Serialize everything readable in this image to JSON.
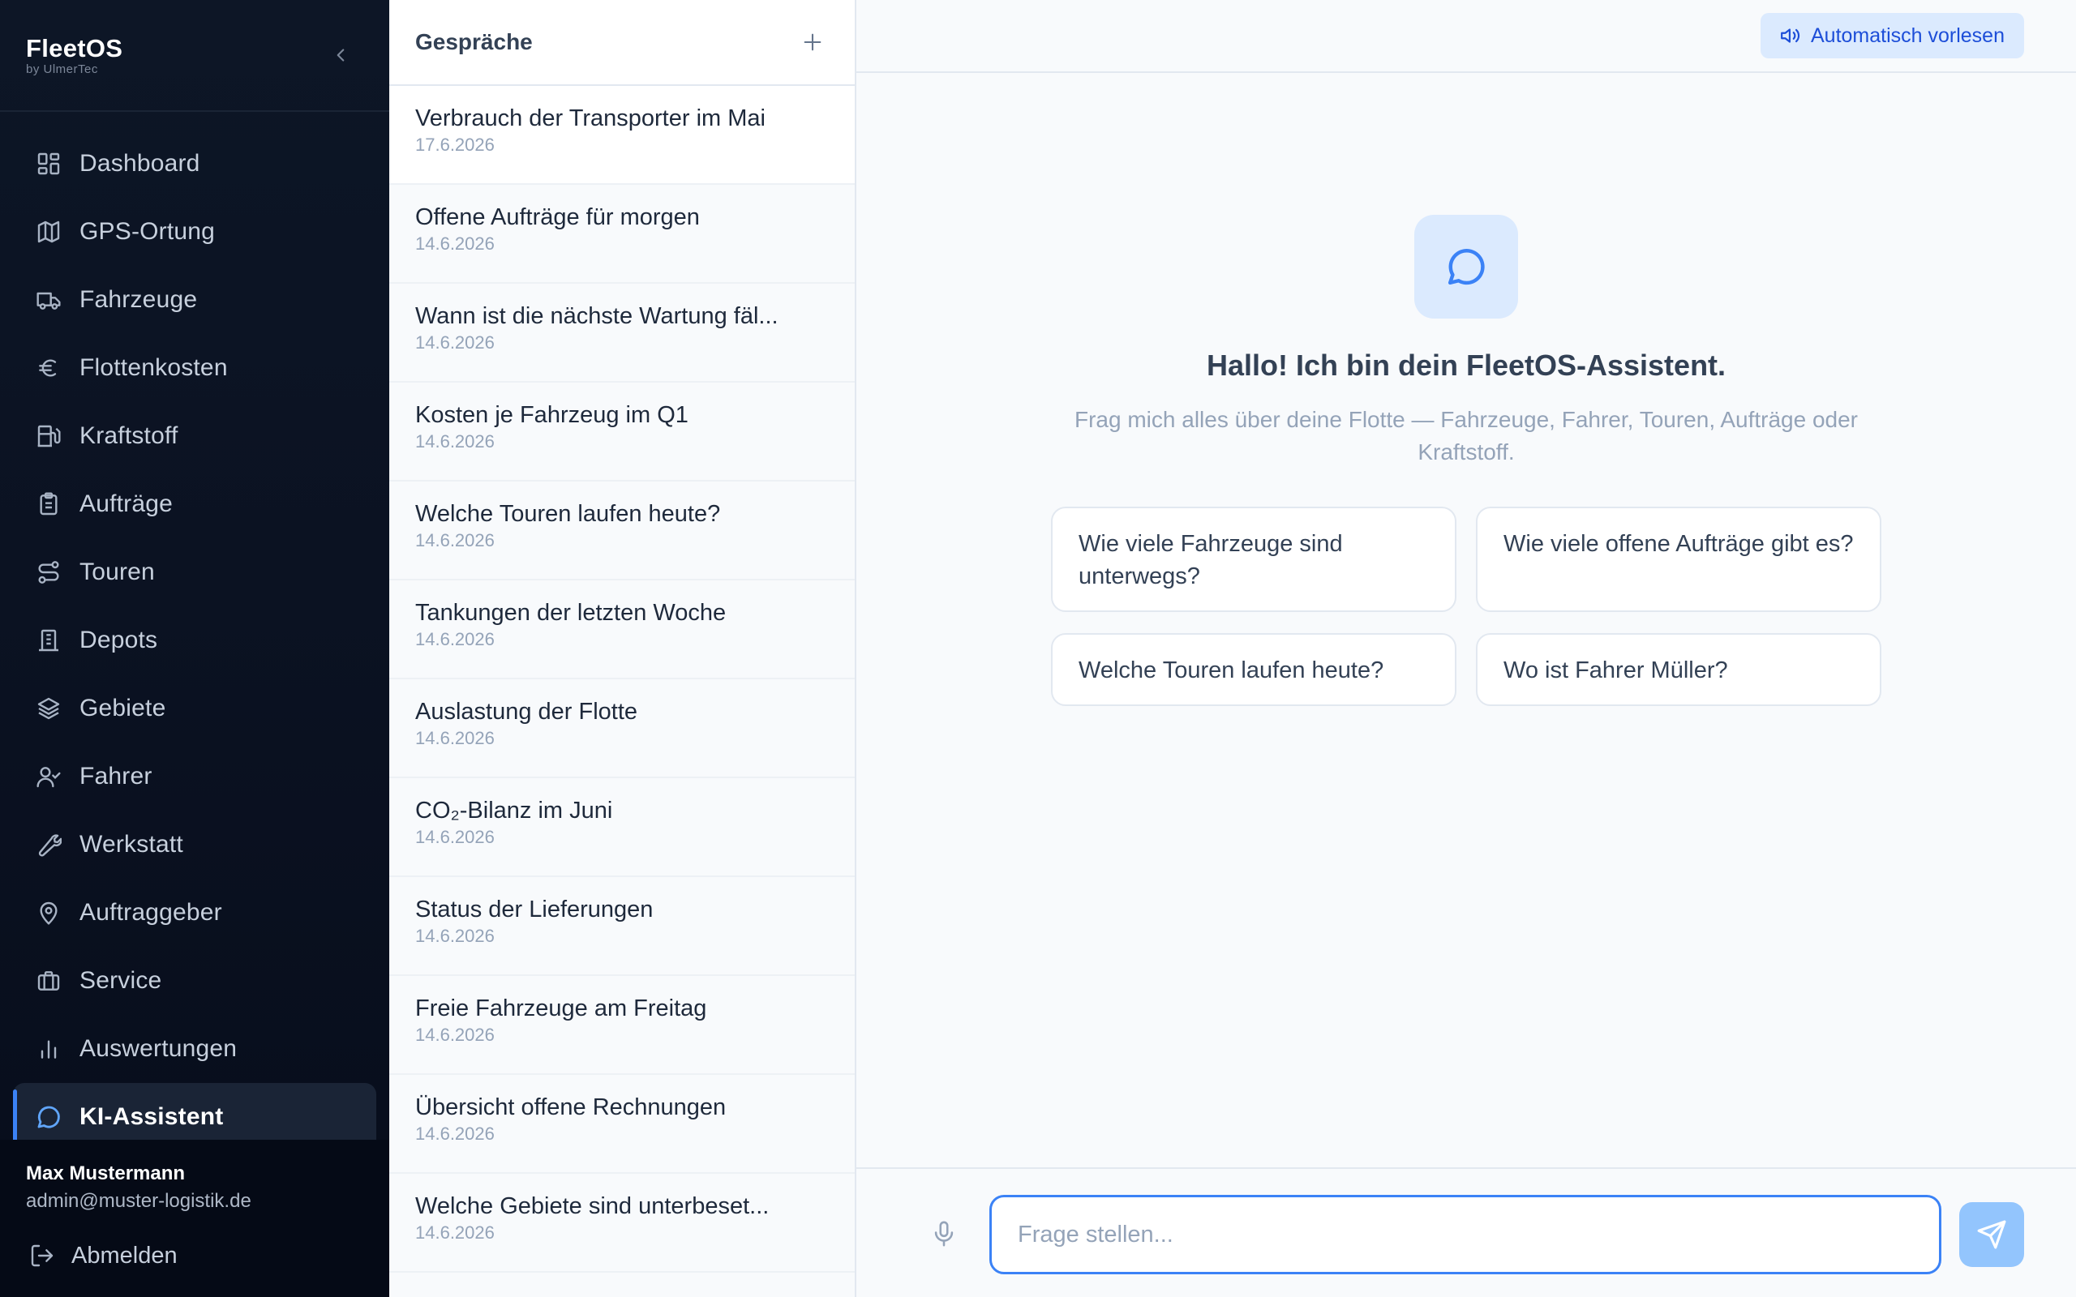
{
  "brand": {
    "name": "FleetOS",
    "subtitle": "by UlmerTec"
  },
  "sidebar": {
    "items": [
      {
        "label": "Dashboard",
        "icon": "dashboard-icon"
      },
      {
        "label": "GPS-Ortung",
        "icon": "map-icon"
      },
      {
        "label": "Fahrzeuge",
        "icon": "truck-icon"
      },
      {
        "label": "Flottenkosten",
        "icon": "euro-icon"
      },
      {
        "label": "Kraftstoff",
        "icon": "fuel-icon"
      },
      {
        "label": "Aufträge",
        "icon": "clipboard-icon"
      },
      {
        "label": "Touren",
        "icon": "route-icon"
      },
      {
        "label": "Depots",
        "icon": "building-icon"
      },
      {
        "label": "Gebiete",
        "icon": "layers-icon"
      },
      {
        "label": "Fahrer",
        "icon": "user-check-icon"
      },
      {
        "label": "Werkstatt",
        "icon": "wrench-icon"
      },
      {
        "label": "Auftraggeber",
        "icon": "map-pin-icon"
      },
      {
        "label": "Service",
        "icon": "briefcase-icon"
      },
      {
        "label": "Auswertungen",
        "icon": "bar-chart-icon"
      },
      {
        "label": "KI-Assistent",
        "icon": "chat-bubble-icon",
        "active": true
      }
    ],
    "user": {
      "name": "Max Mustermann",
      "email": "admin@muster-logistik.de"
    },
    "logout_label": "Abmelden"
  },
  "conversations": {
    "title": "Gespräche",
    "items": [
      {
        "title": "Verbrauch der Transporter im Mai",
        "date": "17.6.2026"
      },
      {
        "title": "Offene Aufträge für morgen",
        "date": "14.6.2026"
      },
      {
        "title": "Wann ist die nächste Wartung fäl...",
        "date": "14.6.2026"
      },
      {
        "title": "Kosten je Fahrzeug im Q1",
        "date": "14.6.2026"
      },
      {
        "title": "Welche Touren laufen heute?",
        "date": "14.6.2026"
      },
      {
        "title": "Tankungen der letzten Woche",
        "date": "14.6.2026"
      },
      {
        "title": "Auslastung der Flotte",
        "date": "14.6.2026"
      },
      {
        "title": "CO₂-Bilanz im Juni",
        "date": "14.6.2026"
      },
      {
        "title": "Status der Lieferungen",
        "date": "14.6.2026"
      },
      {
        "title": "Freie Fahrzeuge am Freitag",
        "date": "14.6.2026"
      },
      {
        "title": "Übersicht offene Rechnungen",
        "date": "14.6.2026"
      },
      {
        "title": "Welche Gebiete sind unterbeset...",
        "date": "14.6.2026"
      }
    ]
  },
  "chat": {
    "tts_label": "Automatisch vorlesen",
    "welcome_title": "Hallo! Ich bin dein FleetOS-Assistent.",
    "welcome_subtitle": "Frag mich alles über deine Flotte — Fahrzeuge, Fahrer, Touren, Aufträge oder Kraftstoff.",
    "suggestions": [
      "Wie viele Fahrzeuge sind unterwegs?",
      "Wie viele offene Aufträge gibt es?",
      "Welche Touren laufen heute?",
      "Wo ist Fahrer Müller?"
    ],
    "input": {
      "value": "",
      "placeholder": "Frage stellen..."
    }
  },
  "colors": {
    "accent": "#3b82f6",
    "sidebar_bg": "#0b1222",
    "send_button": "#93c5fd"
  }
}
